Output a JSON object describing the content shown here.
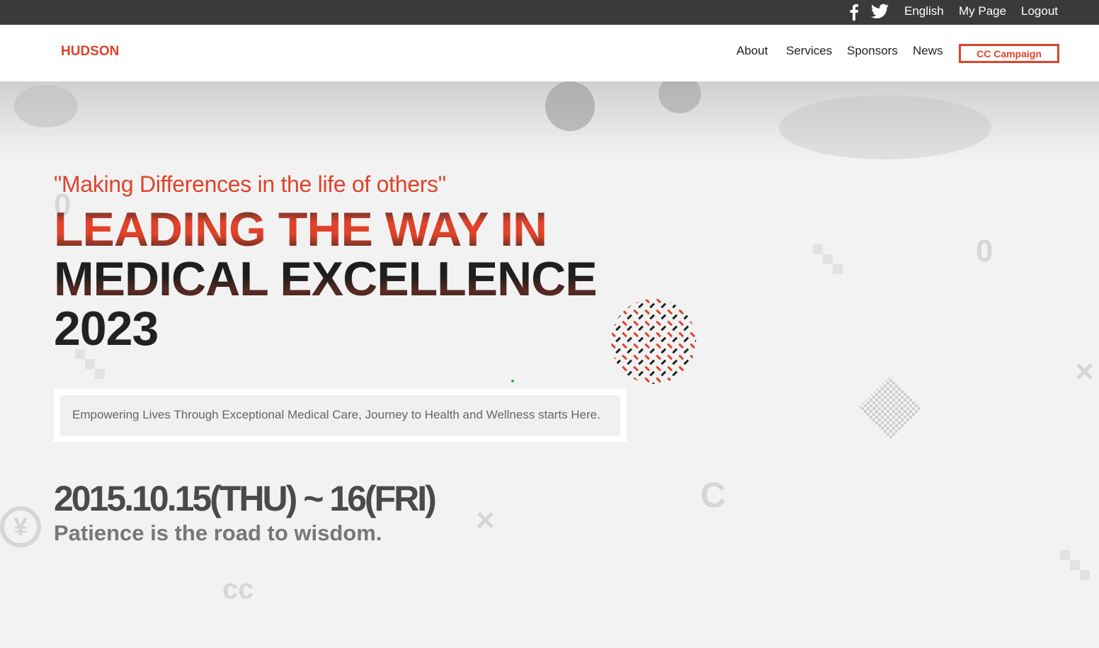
{
  "topbar": {
    "social": [
      "facebook-icon",
      "twitter-icon"
    ],
    "links": [
      "English",
      "My Page",
      "Logout"
    ]
  },
  "header": {
    "logo": "HUDSON",
    "nav": [
      "About",
      "Services",
      "Sponsors",
      "News"
    ],
    "cta": "CC Campaign"
  },
  "hero": {
    "quote": "\"Making Differences in the life of others\"",
    "headline": [
      "LEADING THE WAY IN",
      "MEDICAL EXCELLENCE",
      "2023"
    ],
    "subtitle": "Empowering Lives Through Exceptional Medical Care, Journey to Health and Wellness starts Here.",
    "date": "2015.10.15(THU) ~ 16(FRI)",
    "motto": "Patience is the road to wisdom."
  },
  "colors": {
    "accent": "#e0432a",
    "topbar": "#3a3a3a",
    "text_dark": "#222222"
  }
}
